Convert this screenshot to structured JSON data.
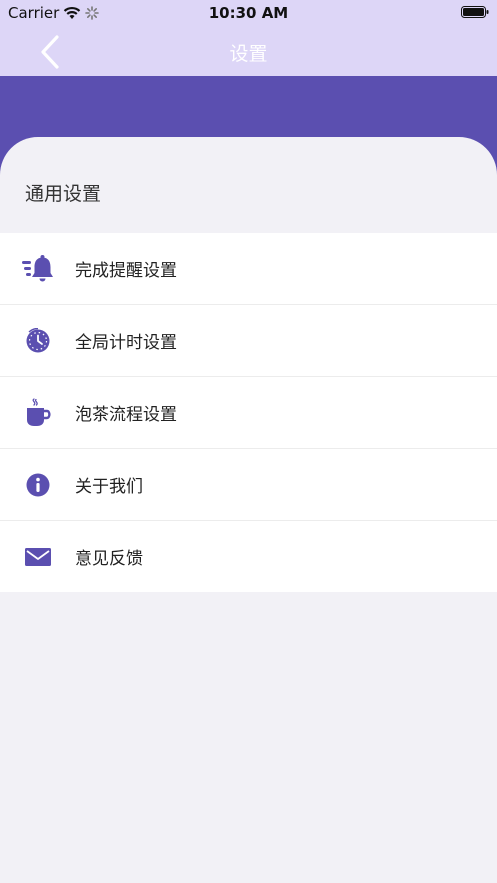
{
  "status_bar": {
    "carrier": "Carrier",
    "time": "10:30 AM"
  },
  "nav": {
    "title": "设置"
  },
  "section": {
    "title": "通用设置"
  },
  "settings_items": [
    {
      "label": "完成提醒设置",
      "icon": "bell-icon"
    },
    {
      "label": "全局计时设置",
      "icon": "clock-icon"
    },
    {
      "label": "泡茶流程设置",
      "icon": "tea-cup-icon"
    },
    {
      "label": "关于我们",
      "icon": "info-icon"
    },
    {
      "label": "意见反馈",
      "icon": "mail-icon"
    }
  ],
  "colors": {
    "accent": "#5b4fb0",
    "nav_background": "#ddd6f7",
    "sheet_background": "#f2f1f6"
  }
}
